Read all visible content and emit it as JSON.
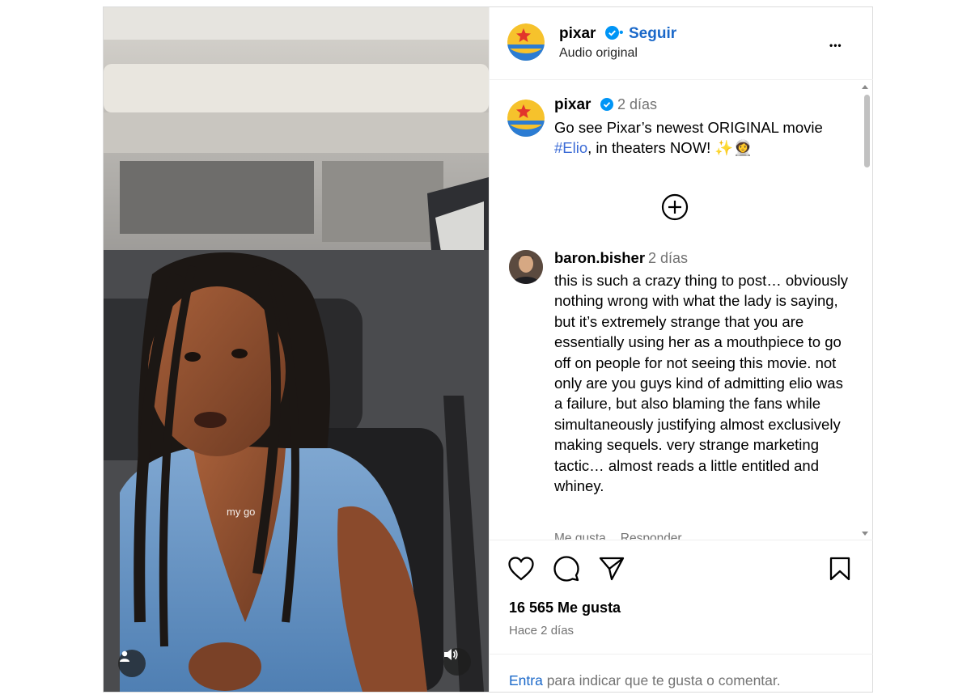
{
  "header": {
    "username": "pixar",
    "separator": "•",
    "follow_label": "Seguir",
    "audio_label": "Audio original",
    "more_label": "•••"
  },
  "video": {
    "caption_overlay": "my go"
  },
  "caption": {
    "username": "pixar",
    "time": "2 días",
    "text_before": "Go see Pixar’s newest ORIGINAL movie ",
    "hashtag": "#Elio",
    "text_after": ", in theaters NOW! ✨👩‍🚀"
  },
  "comment": {
    "username": "baron.bisher",
    "time": "2 días",
    "text": "this is such a crazy thing to post… obviously nothing wrong with what the lady is saying, but it’s extremely strange that you are essentially using her as a mouthpiece to go off on people for not seeing this movie. not only are you guys kind of admitting elio was a failure, but also blaming the fans while simultaneously justifying almost exclusively making sequels. very strange marketing tactic… almost reads a little entitled and whiney.",
    "like_label": "Me gusta",
    "reply_label": "Responder"
  },
  "actions": {
    "likes": "16 565 Me gusta",
    "posted_ago": "Hace 2 días"
  },
  "login": {
    "link": "Entra",
    "text": " para indicar que te gusta o comentar."
  },
  "colors": {
    "link_blue": "#1a68c9",
    "muted": "#737373",
    "verified": "#0095f6"
  }
}
